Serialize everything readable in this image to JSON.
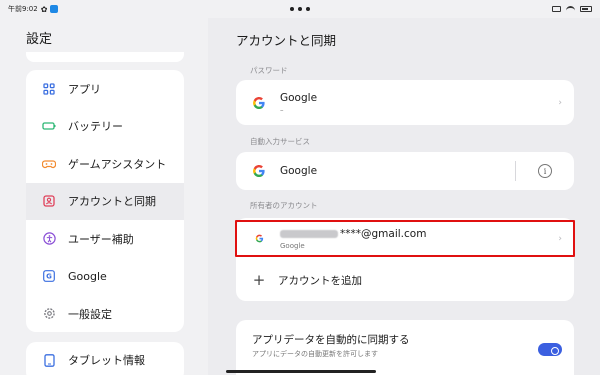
{
  "status": {
    "time": "午前9:02"
  },
  "left": {
    "title": "設定",
    "items": [
      {
        "label": "アプリ",
        "icon": "apps-grid-icon",
        "color": "#3b6fe0"
      },
      {
        "label": "バッテリー",
        "icon": "battery-icon",
        "color": "#2bb673"
      },
      {
        "label": "ゲームアシスタント",
        "icon": "gamepad-icon",
        "color": "#f28b30"
      },
      {
        "label": "アカウントと同期",
        "icon": "account-icon",
        "color": "#e0405a"
      },
      {
        "label": "ユーザー補助",
        "icon": "accessibility-icon",
        "color": "#8a4fd6"
      },
      {
        "label": "Google",
        "icon": "google-icon",
        "color": "#3b6fe0"
      },
      {
        "label": "一般設定",
        "icon": "gear-icon",
        "color": "#7a7a80"
      }
    ],
    "bottom_item": {
      "label": "タブレット情報",
      "icon": "tablet-icon",
      "color": "#3b6fe0"
    }
  },
  "right": {
    "title": "アカウントと同期",
    "password_section": "パスワード",
    "password_item": {
      "title": "Google",
      "sub": "–"
    },
    "autofill_section": "自動入力サービス",
    "autofill_item": "Google",
    "accounts_section": "所有者のアカウント",
    "account_item": {
      "email_suffix": "****@gmail.com",
      "sub": "Google"
    },
    "add_account": "アカウントを追加",
    "sync": {
      "title": "アプリデータを自動的に同期する",
      "sub": "アプリにデータの自動更新を許可します",
      "enabled": true
    }
  },
  "colors": {
    "accent": "#3b5fe0",
    "highlight": "#e01010"
  }
}
